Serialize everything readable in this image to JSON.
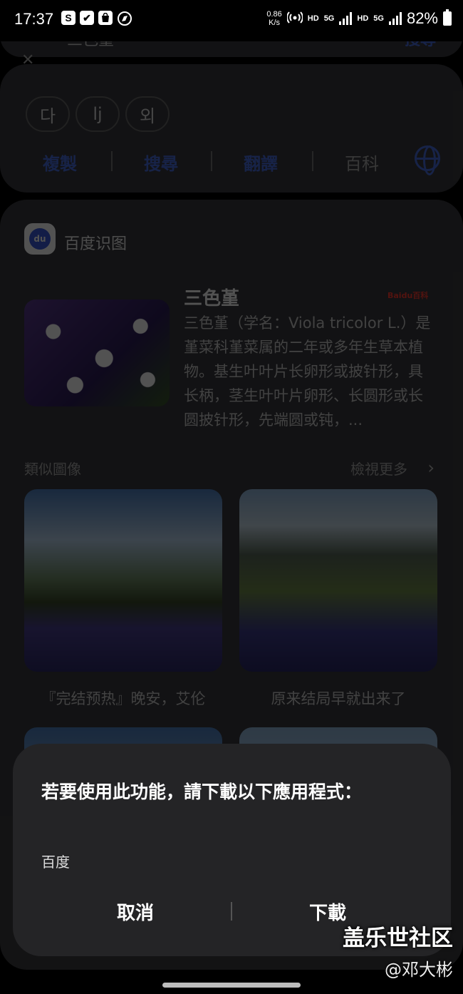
{
  "status_bar": {
    "time": "17:37",
    "left_icons": [
      "S",
      "✔",
      "bag-icon",
      "compass-icon"
    ],
    "net_speed": "0.86",
    "net_unit": "K/s",
    "hd1": "HD",
    "g5a": "5G",
    "hd2": "HD",
    "g5b": "5G",
    "battery": "82%"
  },
  "background": {
    "search_query": "三色堇",
    "search_button": "搜尋",
    "chips": [
      "다",
      "lj",
      "외"
    ],
    "actions": [
      "複製",
      "搜尋",
      "翻譯",
      "百科"
    ],
    "source_name": "百度识图",
    "entry_title": "三色堇",
    "entry_badge": "Baidu百科",
    "entry_desc": "三色堇（学名：Viola tricolor L.）是堇菜科堇菜属的二年或多年生草本植物。基生叶叶片长卵形或披针形，具长柄，茎生叶叶片卵形、长圆形或长圆披针形，先端圆或钝，...",
    "similar_label": "類似圖像",
    "more_label": "檢視更多",
    "captions": [
      "『完结预热』晚安，艾伦",
      "原来结局早就出来了"
    ]
  },
  "dialog": {
    "title": "若要使用此功能，請下載以下應用程式：",
    "app_name": "百度",
    "cancel_label": "取消",
    "download_label": "下載"
  },
  "watermark": {
    "site": "盖乐世社区",
    "user": "@邓大彬"
  },
  "colors": {
    "accent_blue": "#4a6ee0",
    "dialog_bg": "#242426",
    "screen_bg": "#000000"
  }
}
